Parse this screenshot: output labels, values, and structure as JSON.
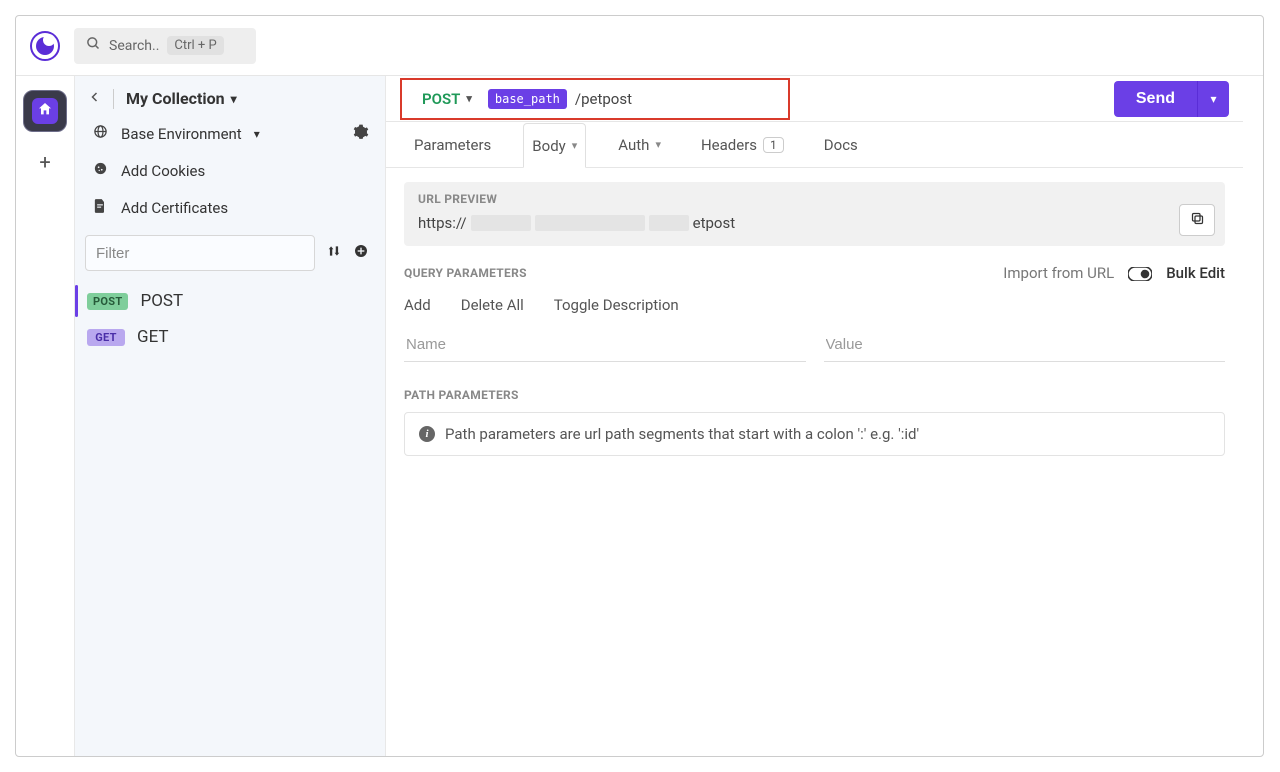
{
  "topbar": {
    "search_placeholder": "Search..",
    "shortcut": "Ctrl + P"
  },
  "rail": {
    "home_icon": "home-icon",
    "add_workspace": "+"
  },
  "sidebar": {
    "collection_title": "My Collection",
    "env_label": "Base Environment",
    "cookies_label": "Add Cookies",
    "certs_label": "Add Certificates",
    "filter_placeholder": "Filter",
    "requests": [
      {
        "method": "POST",
        "label": "POST",
        "active": true
      },
      {
        "method": "GET",
        "label": "GET",
        "active": false
      }
    ]
  },
  "request": {
    "method": "POST",
    "var_chip": "base_path",
    "url_tail": "/petpost",
    "send_label": "Send"
  },
  "tabs": {
    "parameters": "Parameters",
    "body": "Body",
    "auth": "Auth",
    "headers": "Headers",
    "headers_count": "1",
    "docs": "Docs"
  },
  "url_preview": {
    "label": "URL PREVIEW",
    "prefix": "https://",
    "suffix": "etpost"
  },
  "query_params": {
    "label": "QUERY PARAMETERS",
    "import_label": "Import from URL",
    "bulk_label": "Bulk Edit",
    "add": "Add",
    "delete_all": "Delete All",
    "toggle_desc": "Toggle Description",
    "name_ph": "Name",
    "value_ph": "Value"
  },
  "path_params": {
    "label": "PATH PARAMETERS",
    "info": "Path parameters are url path segments that start with a colon ':' e.g. ':id'"
  }
}
